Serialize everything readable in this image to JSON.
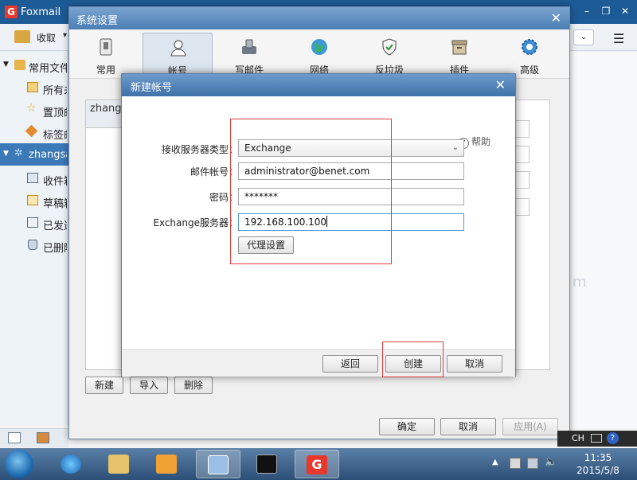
{
  "app": {
    "title": "Foxmail",
    "toolbar": {
      "receive_label": "收取",
      "receive_arrow": "▾"
    },
    "sidebar": {
      "items": [
        {
          "label": "常用文件夹",
          "icon": "folder-icon"
        },
        {
          "label": "所有未读",
          "icon": "folder-icon"
        },
        {
          "label": "置顶邮件",
          "icon": "star-icon"
        },
        {
          "label": "标签邮件",
          "icon": "tag-icon"
        },
        {
          "label": "zhangsan",
          "icon": "account-icon"
        },
        {
          "label": "收件箱",
          "icon": "inbox-icon"
        },
        {
          "label": "草稿箱",
          "icon": "draft-icon"
        },
        {
          "label": "已发送",
          "icon": "sent-icon"
        },
        {
          "label": "已删除",
          "icon": "trash-icon"
        }
      ]
    }
  },
  "settings": {
    "title": "系统设置",
    "tabs": [
      {
        "label": "常用",
        "icon": "general-icon"
      },
      {
        "label": "帐号",
        "icon": "account-icon"
      },
      {
        "label": "写邮件",
        "icon": "compose-icon"
      },
      {
        "label": "网络",
        "icon": "globe-icon"
      },
      {
        "label": "反垃圾",
        "icon": "shield-icon"
      },
      {
        "label": "插件",
        "icon": "plugin-icon"
      },
      {
        "label": "高级",
        "icon": "gear-icon"
      }
    ],
    "selected_tab": "帐号",
    "account_list_item": "zhang",
    "buttons": {
      "new": "新建",
      "import": "导入",
      "delete": "删除",
      "ok": "确定",
      "cancel": "取消",
      "apply": "应用(A)"
    }
  },
  "new_account": {
    "title": "新建帐号",
    "help": "帮助",
    "fields": {
      "server_type_label": "接收服务器类型：",
      "server_type_value": "Exchange",
      "email_label": "邮件帐号：",
      "email_value": "administrator@benet.com",
      "password_label": "密码：",
      "password_value": "*******",
      "exchange_server_label": "Exchange服务器：",
      "exchange_server_value": "192.168.100.100"
    },
    "proxy_button": "代理设置",
    "buttons": {
      "back": "返回",
      "create": "创建",
      "cancel": "取消"
    }
  },
  "taskbar": {
    "clock_time": "11:35",
    "clock_date": "2015/5/8",
    "ime": "CH"
  },
  "colors": {
    "title_blue": "#3f72a9",
    "highlight_red": "#e23b3b",
    "sidebar_selected": "#3b79b7"
  }
}
